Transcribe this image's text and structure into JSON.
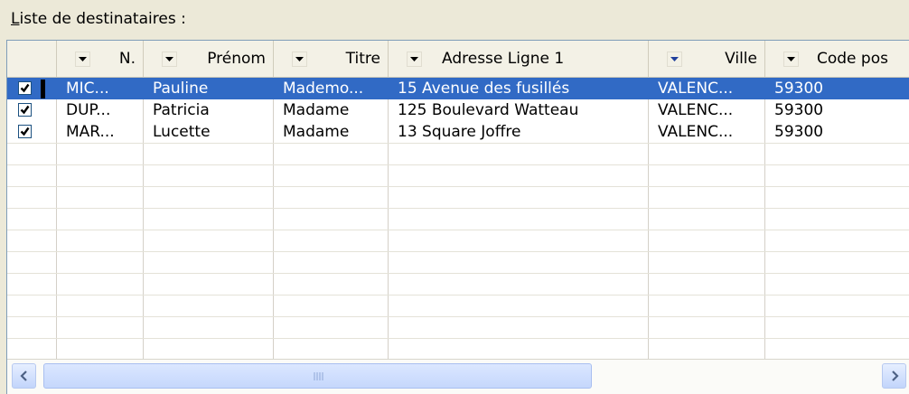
{
  "caption": {
    "first_letter": "L",
    "rest": "iste de destinataires :"
  },
  "columns": [
    {
      "label": "N."
    },
    {
      "label": "Prénom"
    },
    {
      "label": "Titre"
    },
    {
      "label": "Adresse Ligne 1"
    },
    {
      "label": "Ville"
    },
    {
      "label": "Code pos"
    }
  ],
  "rows": [
    {
      "checked": true,
      "selected": true,
      "nom": "MIC...",
      "prenom": "Pauline",
      "titre": "Mademo...",
      "adresse": "15 Avenue des fusillés",
      "ville": "VALENC...",
      "code": "59300"
    },
    {
      "checked": true,
      "selected": false,
      "nom": "DUP...",
      "prenom": "Patricia",
      "titre": "Madame",
      "adresse": "125 Boulevard Watteau",
      "ville": "VALENC...",
      "code": "59300"
    },
    {
      "checked": true,
      "selected": false,
      "nom": "MAR...",
      "prenom": "Lucette",
      "titre": "Madame",
      "adresse": "13 Square Joffre",
      "ville": "VALENC...",
      "code": "59300"
    }
  ],
  "scrollbar": {
    "left_arrow": "<",
    "right_arrow": ">",
    "grip": "|||"
  },
  "colors": {
    "selection": "#316ac5",
    "background": "#ece9d8"
  }
}
